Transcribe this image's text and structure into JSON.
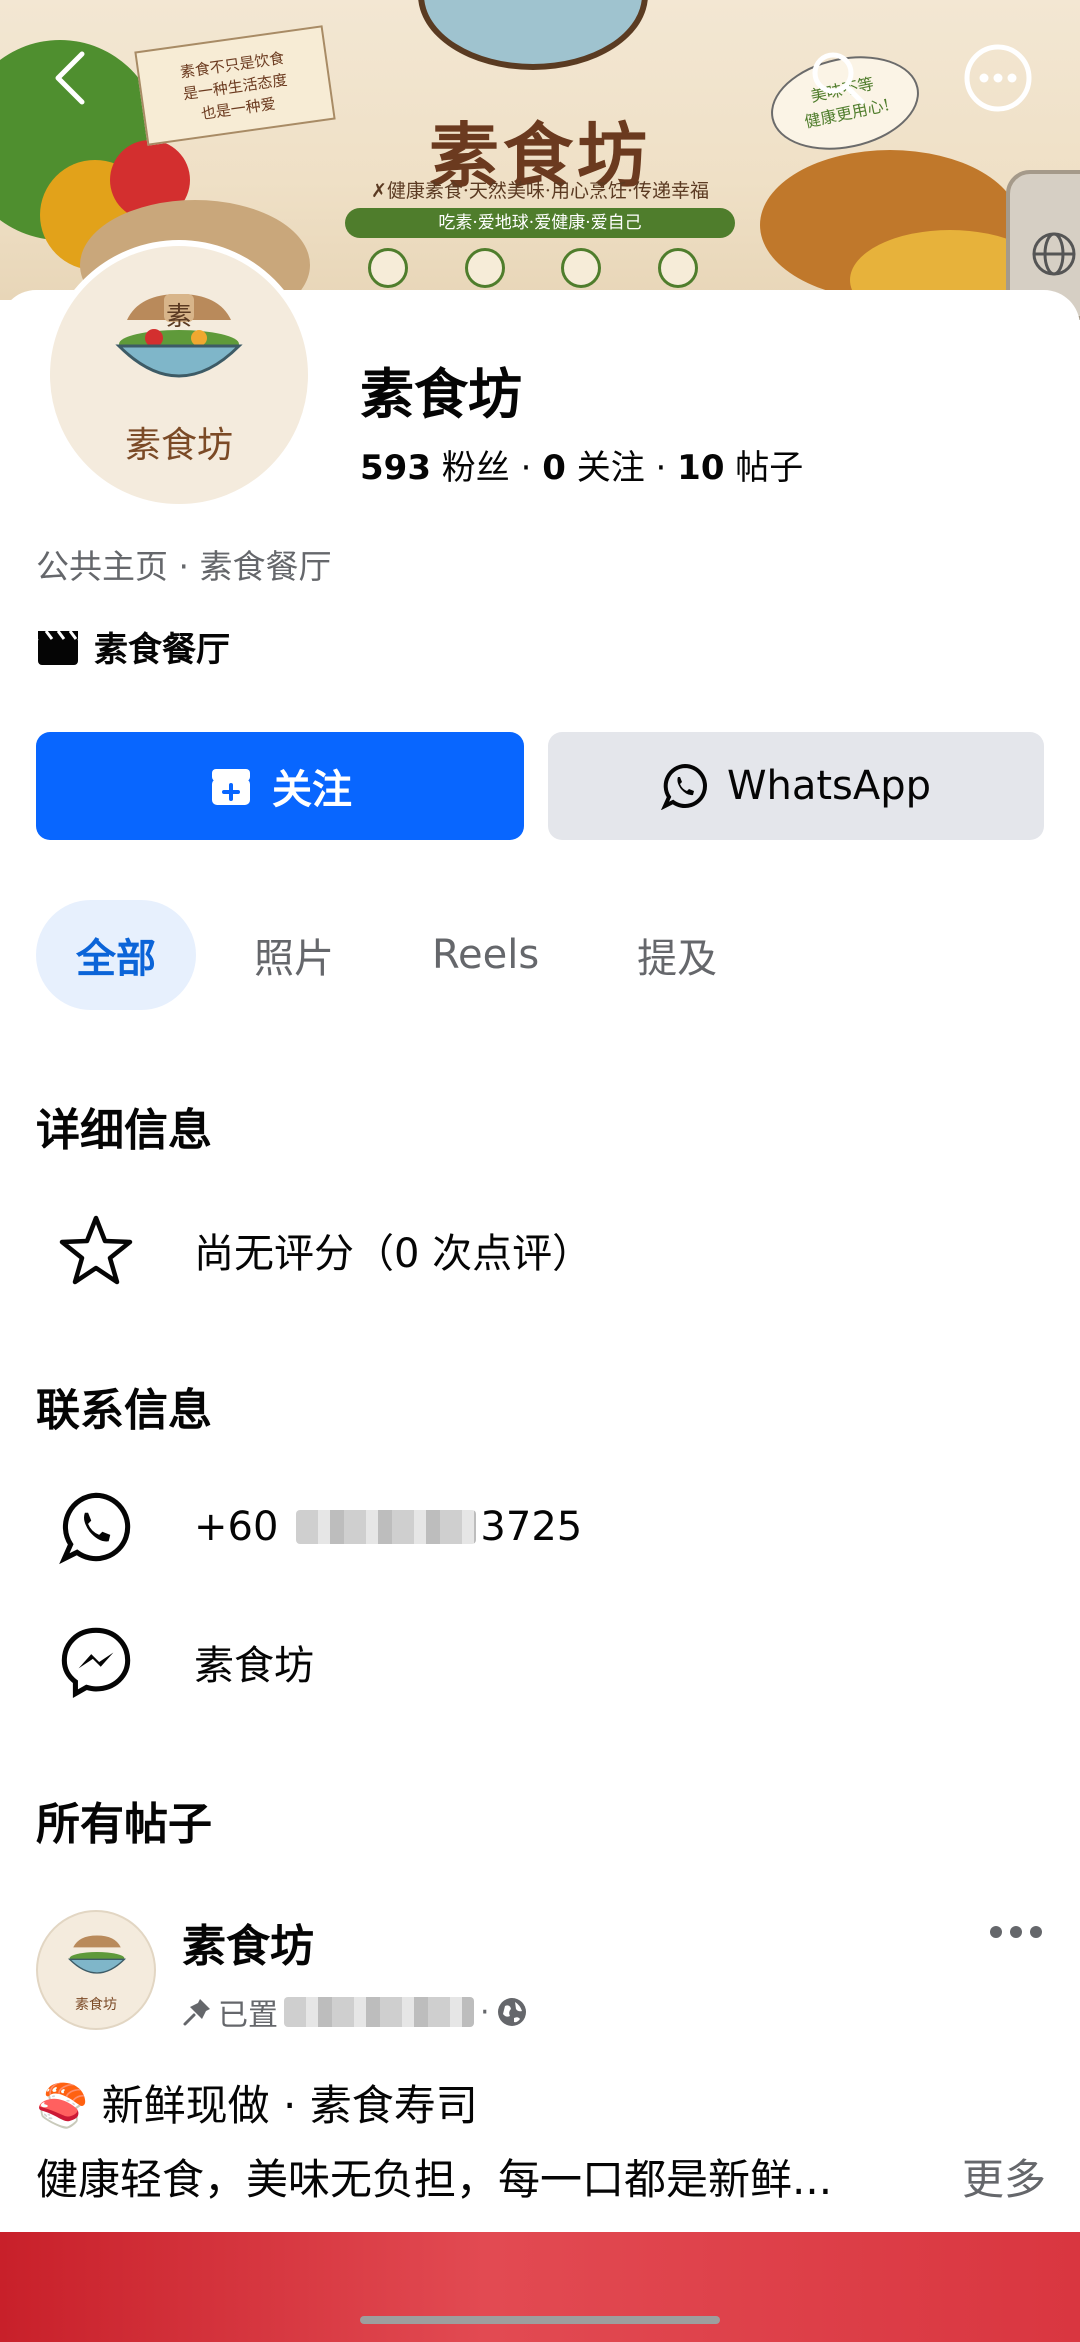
{
  "cover": {
    "title": "素食坊",
    "tagline": "✗健康素食·天然美味·用心烹饪·传递幸福",
    "ribbon": "吃素·爱地球·爱健康·爱自己",
    "note_text": "素食不只是饮食\n是一种生活态度\n也是一种爱",
    "bubble_text": "美味不等\n健康更用心!"
  },
  "profile": {
    "avatar_text": "素食坊",
    "avatar_badge": "素",
    "name": "素食坊",
    "followers_count": "593",
    "followers_label": "粉丝",
    "following_count": "0",
    "following_label": "关注",
    "posts_count": "10",
    "posts_label": "帖子",
    "meta": "公共主页 · 素食餐厅",
    "category": "素食餐厅"
  },
  "actions": {
    "follow_label": "关注",
    "whatsapp_label": "WhatsApp"
  },
  "tabs": [
    {
      "label": "全部",
      "active": true
    },
    {
      "label": "照片",
      "active": false
    },
    {
      "label": "Reels",
      "active": false
    },
    {
      "label": "提及",
      "active": false
    }
  ],
  "details": {
    "title": "详细信息",
    "rating_text": "尚无评分（0 次点评）"
  },
  "contact": {
    "title": "联系信息",
    "phone_prefix": "+60",
    "phone_suffix": "3725",
    "messenger_name": "素食坊"
  },
  "posts": {
    "title": "所有帖子",
    "author": "素食坊",
    "author_avatar_text": "素食坊",
    "pinned_label": "已置",
    "emoji": "🍣",
    "line1": "新鲜现做 · 素食寿司",
    "line2": "健康轻食，美味无负担，每一口都是新鲜...",
    "more_label": "更多"
  },
  "colors": {
    "brand_blue": "#0866ff",
    "secondary_grey": "#e4e6eb",
    "active_tab_bg": "#e7f0fd",
    "active_tab_text": "#0b64d8",
    "muted_text": "#65676b"
  },
  "icons": {
    "back": "chevron-left-icon",
    "search": "search-icon",
    "more": "more-icon",
    "follow": "follow-icon",
    "whatsapp": "whatsapp-icon",
    "star": "star-icon",
    "messenger": "messenger-icon",
    "pin": "pin-icon",
    "globe": "globe-icon",
    "category": "clapper-icon"
  }
}
